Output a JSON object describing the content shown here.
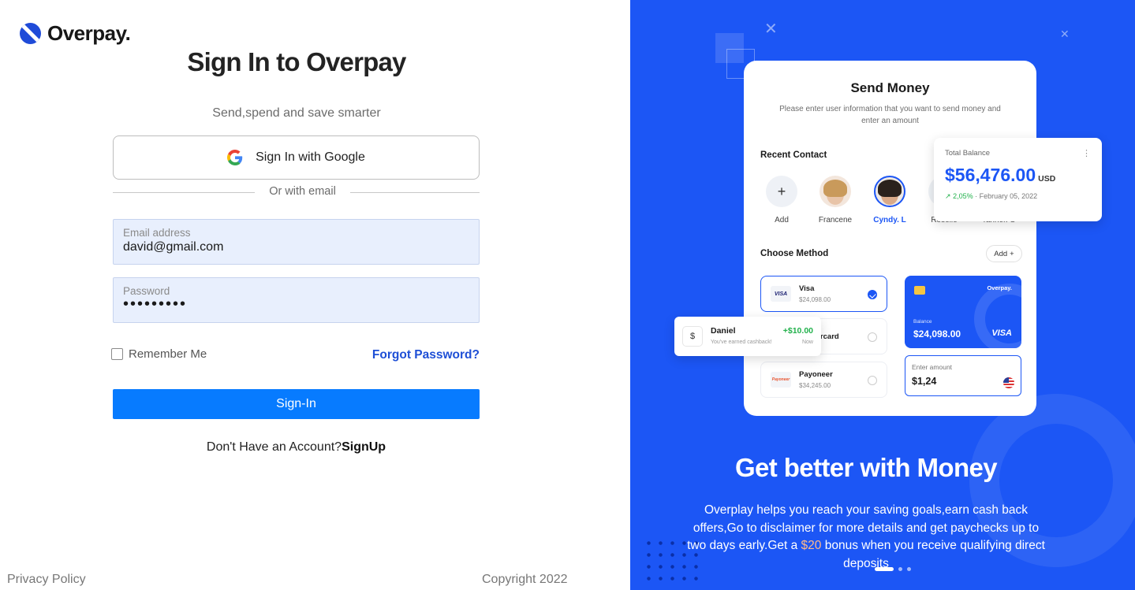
{
  "brand": {
    "name": "Overpay."
  },
  "login": {
    "title": "Sign In to Overpay",
    "subtitle": "Send,spend and save smarter",
    "google_label": "Sign In with Google",
    "divider_text": "Or with email",
    "email": {
      "label": "Email address",
      "value": "david@gmail.com"
    },
    "password": {
      "label": "Password",
      "value": "•••••••••"
    },
    "remember_label": "Remember Me",
    "remember_checked": false,
    "forgot_label": "Forgot Password?",
    "signin_label": "Sign-In",
    "no_account_text": "Don't Have an Account?",
    "signup_label": "SignUp"
  },
  "footer": {
    "privacy": "Privacy Policy",
    "copyright": "Copyright 2022"
  },
  "promo": {
    "card": {
      "title": "Send Money",
      "description": "Please enter user information that you want to send money and enter an amount",
      "recent_contact_title": "Recent Contact",
      "contacts": [
        {
          "name": "Add",
          "icon": "plus-icon"
        },
        {
          "name": "Francene"
        },
        {
          "name": "Cyndy. L",
          "selected": true
        },
        {
          "name": "Roselle"
        },
        {
          "name": "Tanner. S"
        }
      ],
      "choose_method_title": "Choose Method",
      "add_label": "Add",
      "methods": [
        {
          "name": "Visa",
          "amount": "$24,098.00",
          "logo": "VISA",
          "selected": true
        },
        {
          "name": "Mastercard",
          "amount": "",
          "logo": ""
        },
        {
          "name": "Payoneer",
          "amount": "$34,245.00",
          "logo": "Payoneer"
        }
      ],
      "bank_card": {
        "brand": "Overpay.",
        "balance_label": "Balance",
        "balance": "$24,098.00",
        "network": "VISA"
      },
      "enter_amount": {
        "label": "Enter amount",
        "value": "$1,24"
      }
    },
    "balance": {
      "label": "Total Balance",
      "amount": "$56,476.00",
      "currency": "USD",
      "change": "2,05%",
      "date": "February 05, 2022"
    },
    "notification": {
      "name": "Daniel",
      "amount": "+$10.00",
      "subtitle": "You've earned cashback!",
      "time": "Now"
    },
    "headline": "Get better with Money",
    "body_before": "Overplay helps you reach your saving goals,earn cash back offers,Go to disclaimer for more details and get paychecks up to two days early.Get a ",
    "body_highlight": "$20",
    "body_after": " bonus when you receive qualifying direct deposits",
    "pager_count": 3,
    "pager_active": 0,
    "colors": {
      "accent": "#1c56f5",
      "primary_button": "#077bff",
      "link": "#1e4fd6",
      "positive": "#22b14c"
    }
  }
}
